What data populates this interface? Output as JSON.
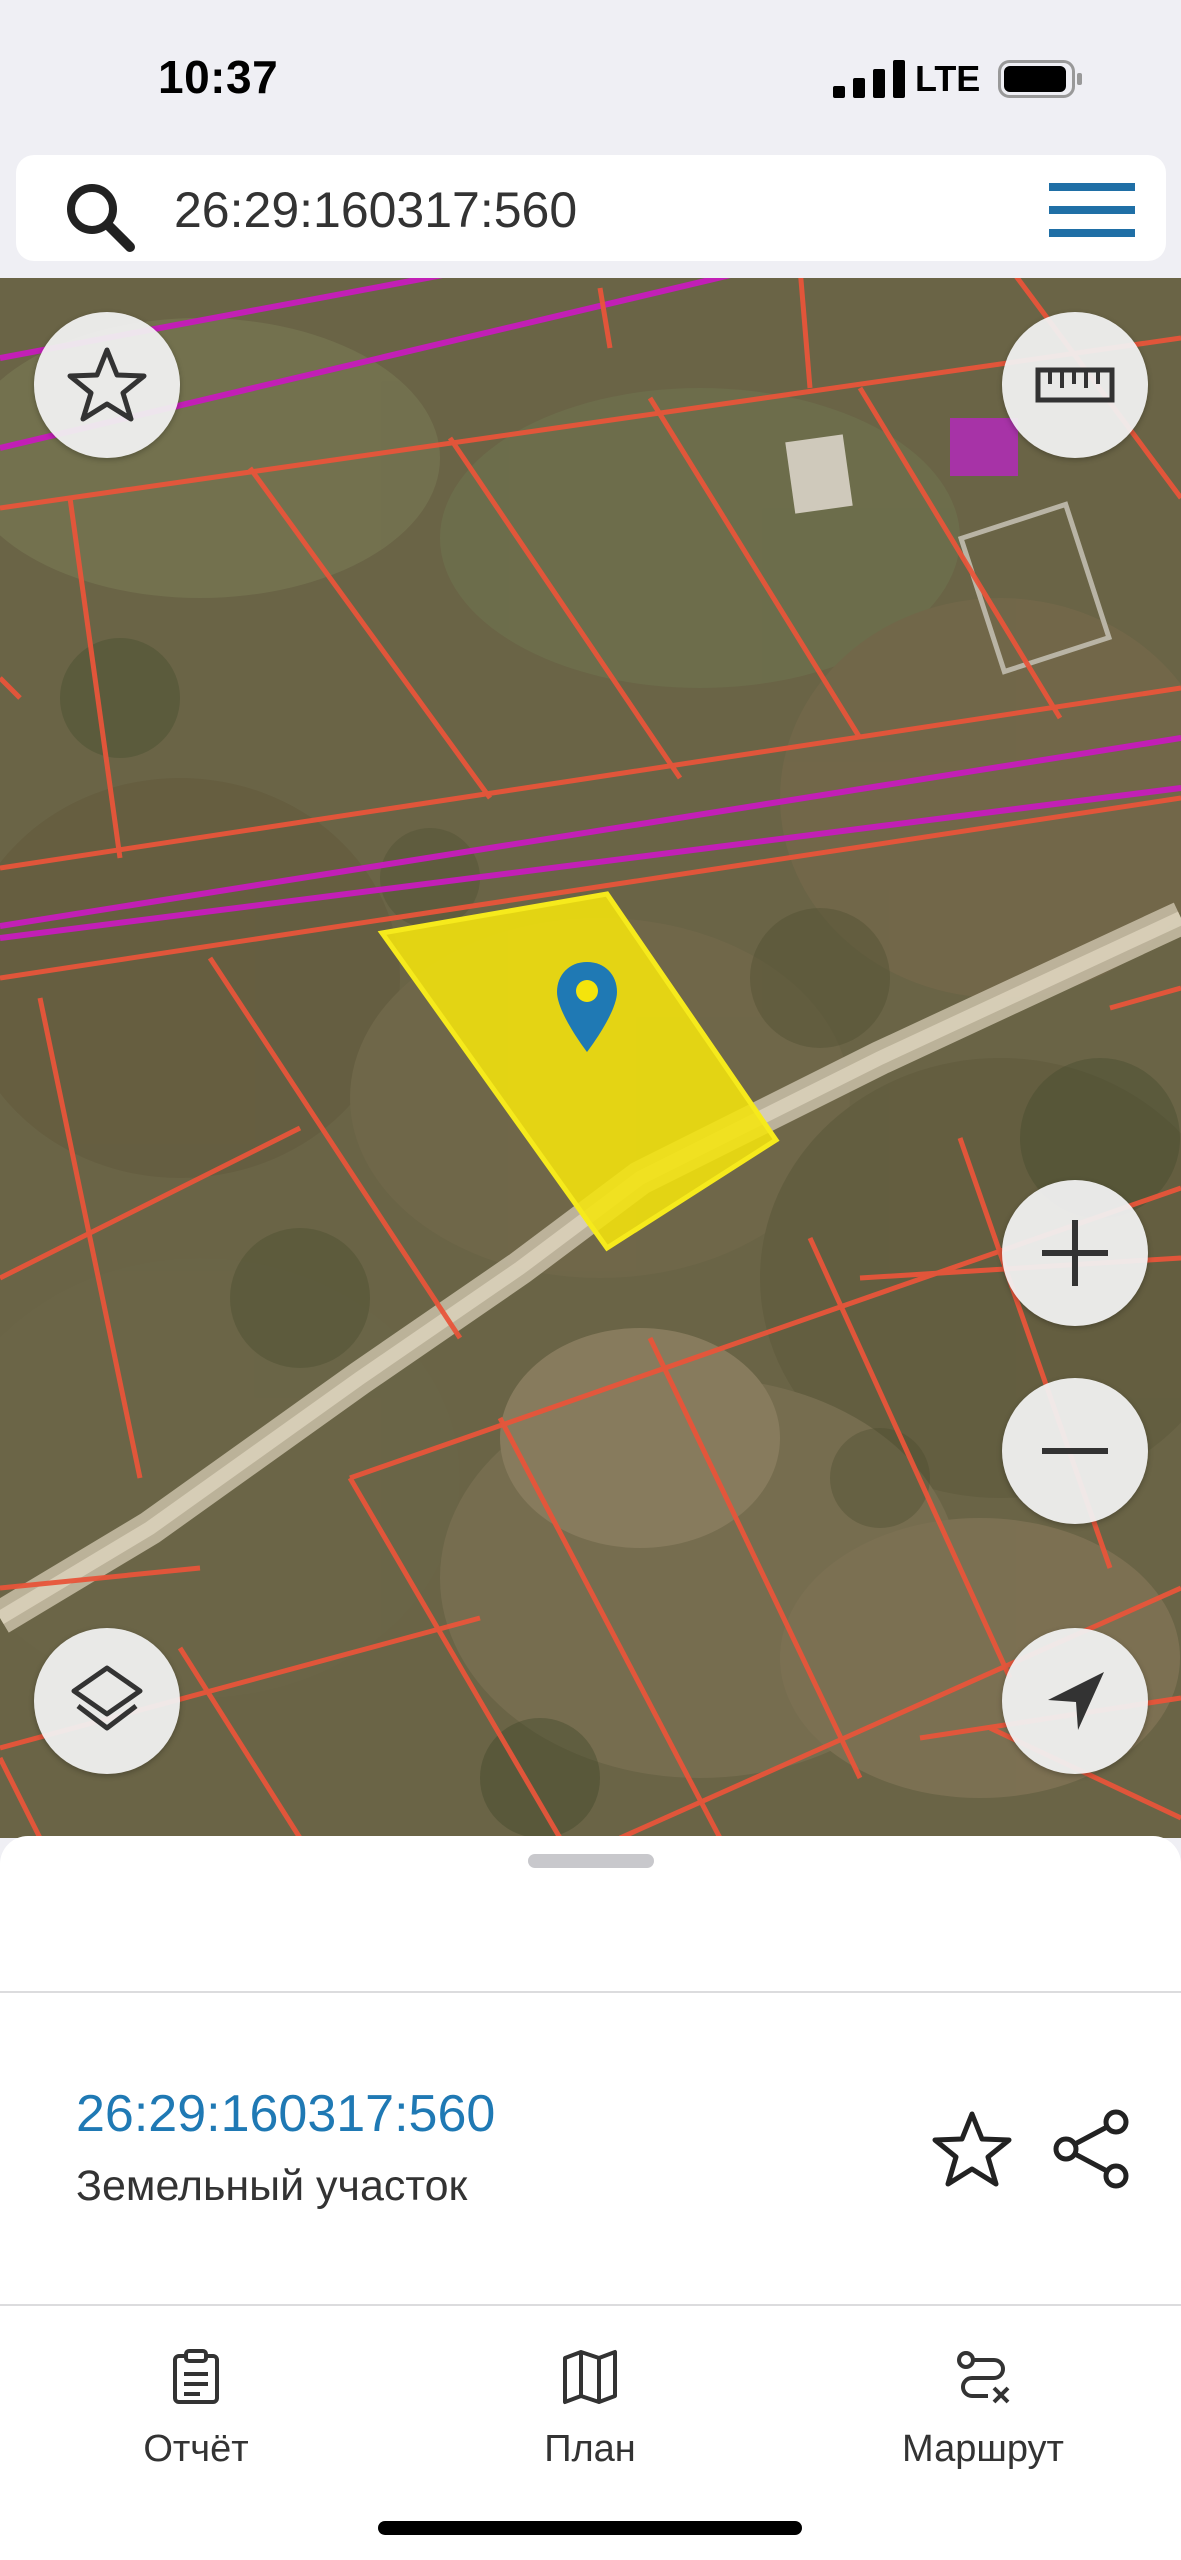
{
  "status_bar": {
    "time": "10:37",
    "network": "LTE"
  },
  "search": {
    "query": "26:29:160317:560"
  },
  "map": {
    "icons": [
      "favorite-star-icon",
      "ruler-icon",
      "plus-icon",
      "minus-icon",
      "layers-icon",
      "location-arrow-icon",
      "map-pin-icon"
    ],
    "colors": {
      "parcel_fill": "#f4e40c",
      "boundary": "#e8553a",
      "zone": "#c21fb6",
      "pin": "#1f79b4"
    }
  },
  "parcel": {
    "cadastral_number": "26:29:160317:560",
    "type": "Земельный участок"
  },
  "tabs": [
    {
      "label": "Отчёт",
      "icon": "clipboard-icon"
    },
    {
      "label": "План",
      "icon": "map-icon"
    },
    {
      "label": "Маршрут",
      "icon": "route-icon"
    }
  ]
}
